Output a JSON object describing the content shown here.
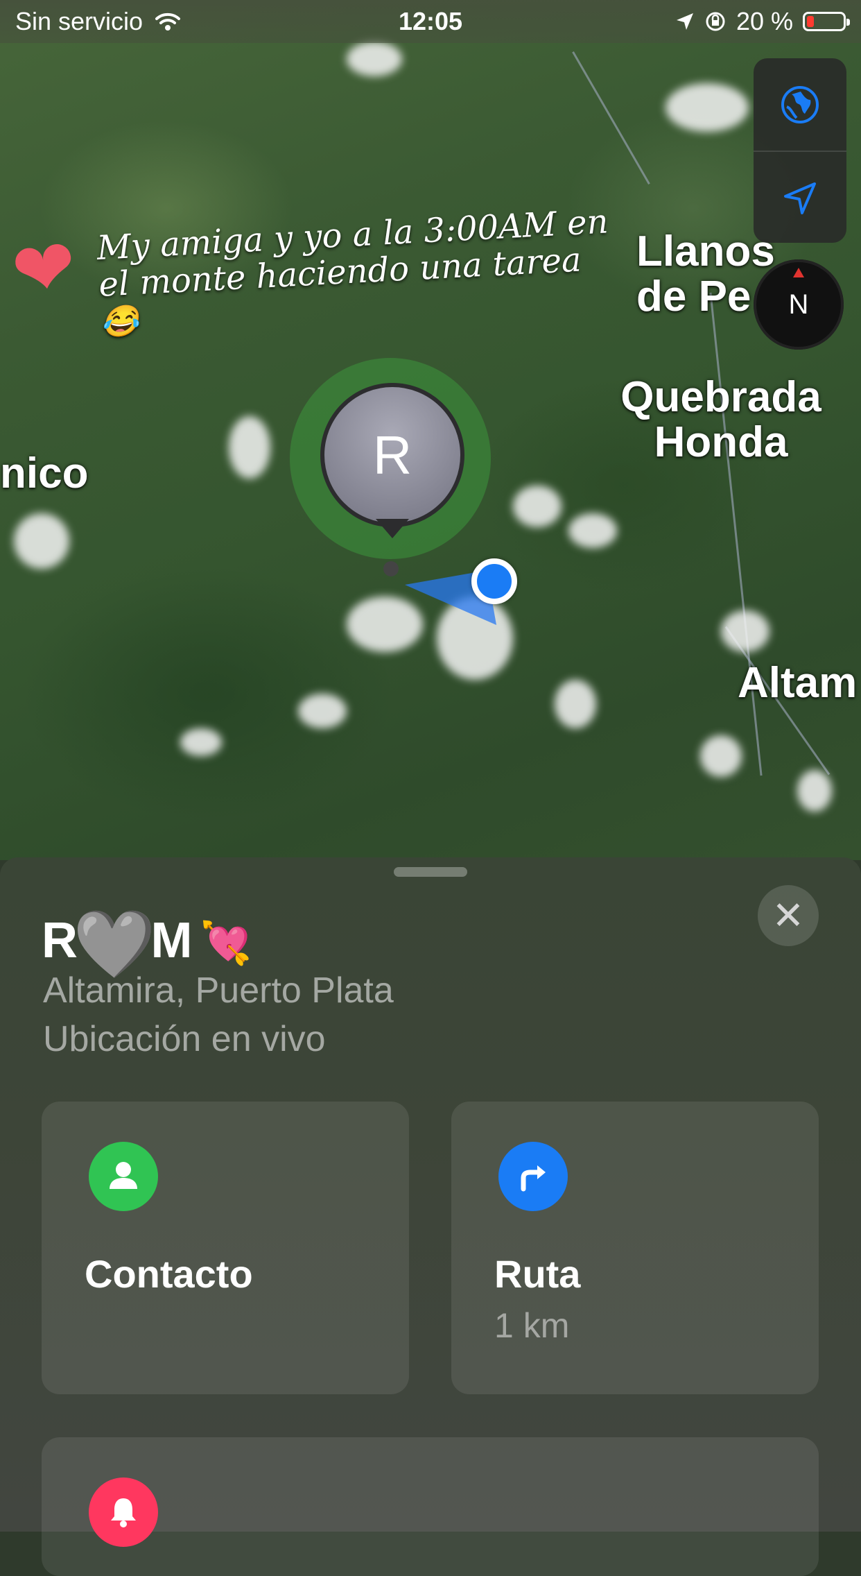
{
  "status_bar": {
    "carrier": "Sin servicio",
    "time": "12:05",
    "battery": "20 %",
    "battery_level": 0.2
  },
  "map": {
    "caption": "My amiga y yo a la 3:00AM en el monte haciendo una tarea",
    "caption_emoji": "😂",
    "heart_emoji": "❤",
    "place_labels": [
      "Llanos de Pe",
      "Quebrada Honda",
      "nico",
      "Altam"
    ],
    "pin_initial": "R",
    "compass_label": "N",
    "controls": {
      "globe": "globe-icon",
      "location": "location-arrow-icon"
    }
  },
  "sheet": {
    "name_prefix": "R",
    "name_heart": "🩶",
    "name_suffix": "M",
    "name_emoji": "💘",
    "close_icon": "✕",
    "location": "Altamira, Puerto Plata",
    "status": "Ubicación en vivo",
    "cards": {
      "contact": {
        "label": "Contacto",
        "icon": "person-icon",
        "color": "#30c453"
      },
      "route": {
        "label": "Ruta",
        "distance": "1 km",
        "icon": "route-arrow-icon",
        "color": "#1a7cf5"
      },
      "notify": {
        "icon": "bell-icon",
        "color": "#ff375f"
      }
    }
  },
  "colors": {
    "accent": "#1a7cf5"
  }
}
